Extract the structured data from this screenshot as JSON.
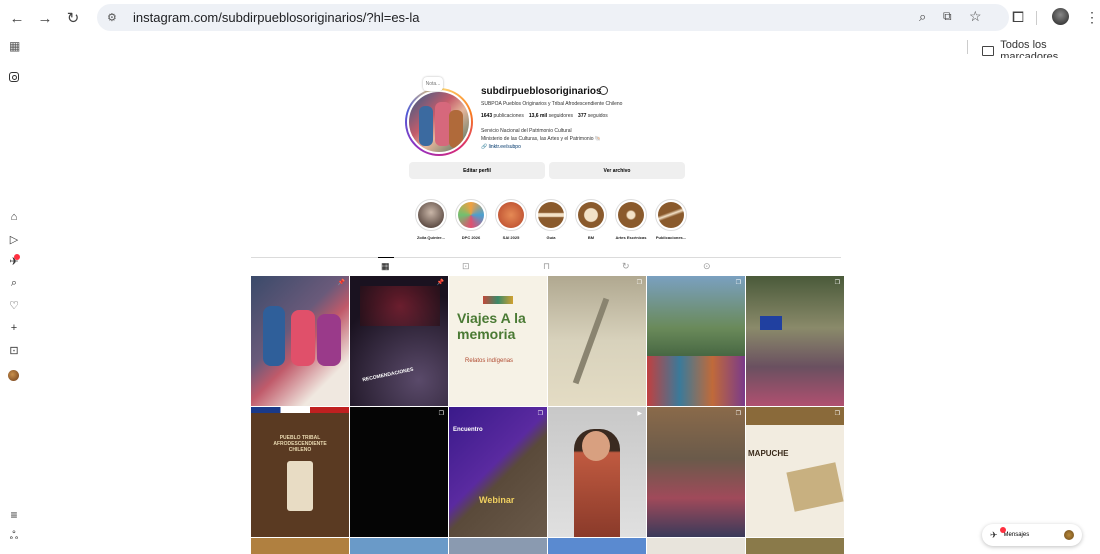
{
  "browser": {
    "url": "instagram.com/subdirpueblosoriginarios/?hl=es-la",
    "bookmarks_folder": "Todos los marcadores"
  },
  "profile": {
    "note": "Nota...",
    "username": "subdirpueblosoriginarios",
    "full_name": "SUBPOA Pueblos Originarios y Tribal Afrodescendiente Chileno",
    "posts_count": "1643",
    "posts_label": "publicaciones",
    "followers_count": "13,6 mil",
    "followers_label": "seguidores",
    "following_count": "377",
    "following_label": "seguidos",
    "bio_line1": "Servicio Nacional del Patrimonio Cultural",
    "bio_line2": "Ministerio de las Culturas, las Artes y el Patrimonio 🐚",
    "link": "linktr.ee/subpo",
    "edit_button": "Editar perfil",
    "archive_button": "Ver archivo"
  },
  "highlights": [
    {
      "label": "Zoila Quintre..."
    },
    {
      "label": "DPC 2026"
    },
    {
      "label": "SAI 2025"
    },
    {
      "label": "Guía"
    },
    {
      "label": "BM"
    },
    {
      "label": "Artes Escénicas"
    },
    {
      "label": "Publicaciones..."
    }
  ],
  "posts": [
    {
      "text": ""
    },
    {
      "text": "RECOMENDACIONES"
    },
    {
      "text": "Viajes A la memoria",
      "subtext": "Relatos indígenas"
    },
    {
      "text": ""
    },
    {
      "text": ""
    },
    {
      "text": ""
    },
    {
      "text": "PUEBLO TRIBAL AFRODESCENDIENTE CHILENO"
    },
    {
      "text": ""
    },
    {
      "text": "Encuentro",
      "subtext": "Webinar"
    },
    {
      "text": ""
    },
    {
      "text": ""
    },
    {
      "text": "MAPUCHE"
    }
  ],
  "messages": {
    "label": "Mensajes"
  },
  "colors": {
    "link": "#00376b",
    "notification": "#ff3040",
    "button_bg": "#efefef"
  }
}
